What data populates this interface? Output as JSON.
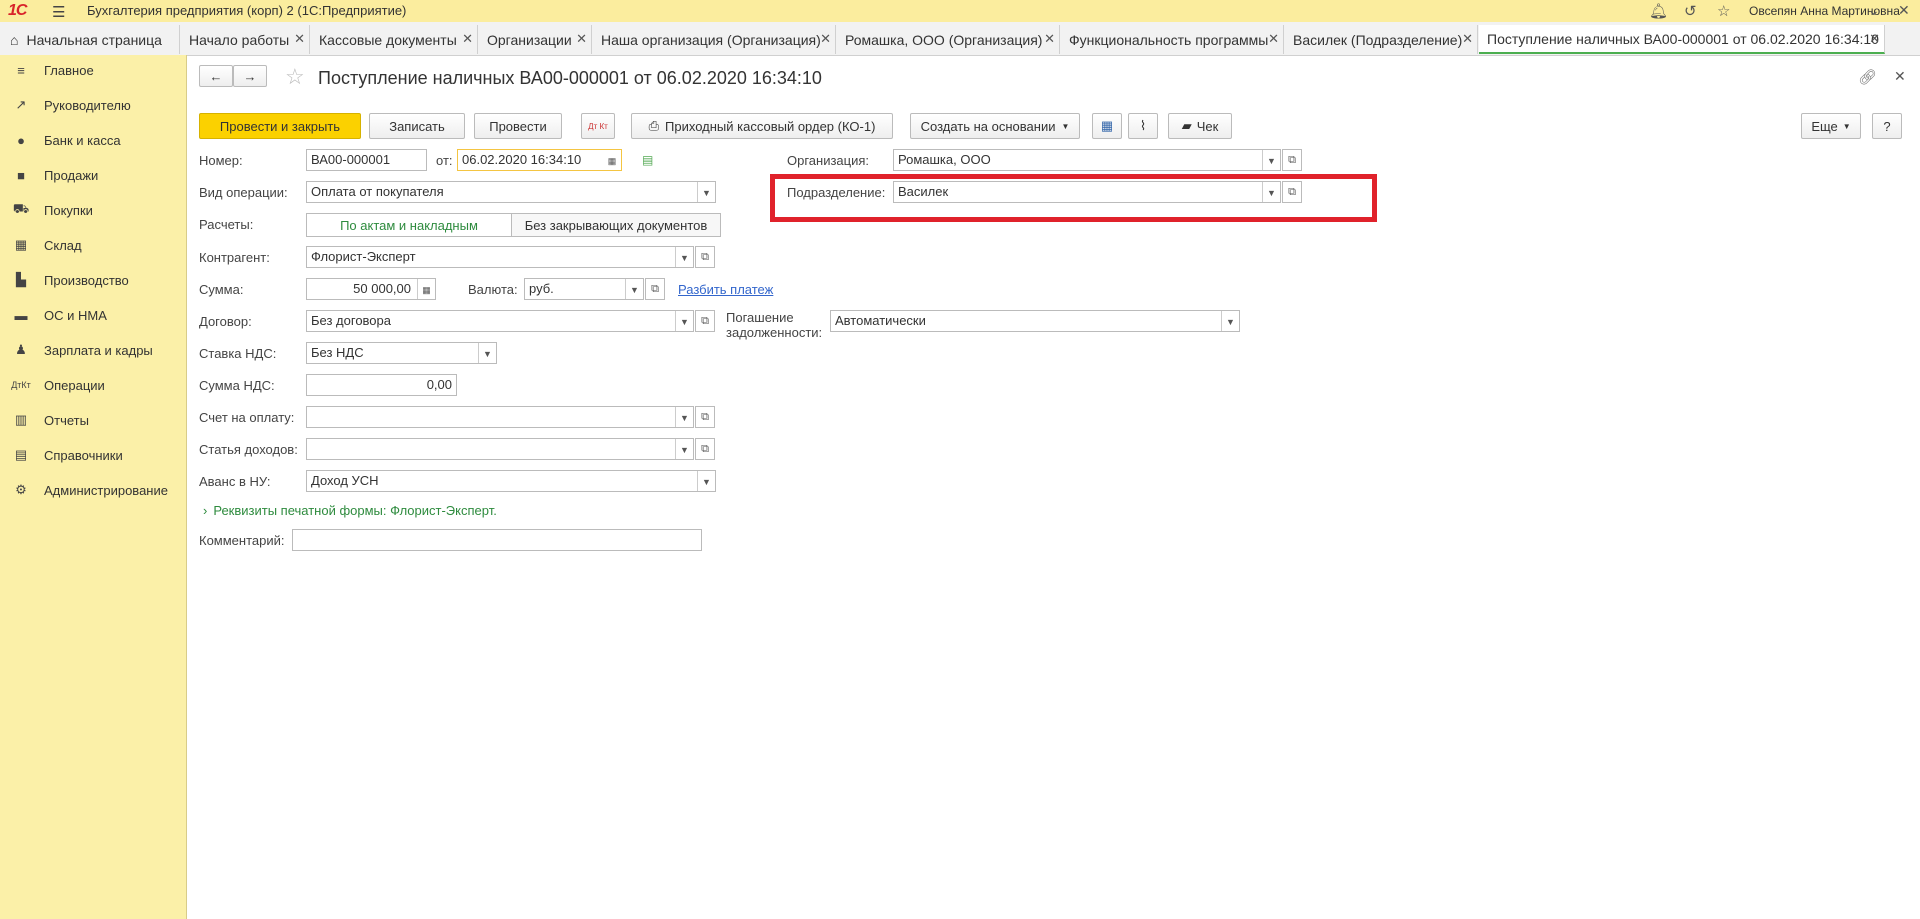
{
  "titlebar": {
    "logo": "1С",
    "app_title": "Бухгалтерия предприятия (корп) 2  (1С:Предприятие)",
    "user": "Овсепян Анна Мартиновна"
  },
  "tabs": [
    {
      "label": "Начальная страница"
    },
    {
      "label": "Начало работы"
    },
    {
      "label": "Кассовые документы"
    },
    {
      "label": "Организации"
    },
    {
      "label": "Наша организация (Организация)"
    },
    {
      "label": "Ромашка, ООО (Организация)"
    },
    {
      "label": "Функциональность программы"
    },
    {
      "label": "Василек (Подразделение)"
    },
    {
      "label": "Поступление наличных ВА00-000001 от 06.02.2020 16:34:10"
    }
  ],
  "sidebar": {
    "items": [
      {
        "label": "Главное",
        "icon": "menu-icon"
      },
      {
        "label": "Руководителю",
        "icon": "chart-up-icon"
      },
      {
        "label": "Банк и касса",
        "icon": "coin-icon"
      },
      {
        "label": "Продажи",
        "icon": "bag-icon"
      },
      {
        "label": "Покупки",
        "icon": "cart-icon"
      },
      {
        "label": "Склад",
        "icon": "grid-icon"
      },
      {
        "label": "Производство",
        "icon": "factory-icon"
      },
      {
        "label": "ОС и НМА",
        "icon": "truck-icon"
      },
      {
        "label": "Зарплата и кадры",
        "icon": "person-icon"
      },
      {
        "label": "Операции",
        "icon": "dt-kt-icon"
      },
      {
        "label": "Отчеты",
        "icon": "bar-chart-icon"
      },
      {
        "label": "Справочники",
        "icon": "books-icon"
      },
      {
        "label": "Администрирование",
        "icon": "gear-icon"
      }
    ]
  },
  "document": {
    "title": "Поступление наличных ВА00-000001 от 06.02.2020 16:34:10"
  },
  "toolbar": {
    "post_close": "Провести и закрыть",
    "save": "Записать",
    "post": "Провести",
    "dt_kt": "Дт Кт",
    "print": "Приходный кассовый ордер (КО-1)",
    "create_based": "Создать на основании",
    "receipt": "Чек",
    "more": "Еще",
    "help": "?"
  },
  "form": {
    "number_label": "Номер:",
    "number_value": "ВА00-000001",
    "from_label": "от:",
    "date_value": "06.02.2020 16:34:10",
    "op_label": "Вид операции:",
    "op_value": "Оплата от покупателя",
    "settle_label": "Расчеты:",
    "settle_opt1": "По актам и накладным",
    "settle_opt2": "Без закрывающих документов",
    "contractor_label": "Контрагент:",
    "contractor_value": "Флорист-Эксперт",
    "sum_label": "Сумма:",
    "sum_value": "50 000,00",
    "currency_label": "Валюта:",
    "currency_value": "руб.",
    "split_link": "Разбить платеж",
    "contract_label": "Договор:",
    "contract_value": "Без договора",
    "debt_label_1": "Погашение",
    "debt_label_2": "задолженности:",
    "debt_value": "Автоматически",
    "vat_rate_label": "Ставка НДС:",
    "vat_rate_value": "Без НДС",
    "vat_sum_label": "Сумма НДС:",
    "vat_sum_value": "0,00",
    "invoice_label": "Счет на оплату:",
    "invoice_value": "",
    "income_label": "Статья доходов:",
    "income_value": "",
    "advance_label": "Аванс в НУ:",
    "advance_value": "Доход УСН",
    "print_details": "Реквизиты печатной формы: Флорист-Эксперт.",
    "comment_label": "Комментарий:",
    "comment_value": "",
    "org_label": "Организация:",
    "org_value": "Ромашка, ООО",
    "dept_label": "Подразделение:",
    "dept_value": "Василек"
  },
  "colors": {
    "sidebar_bg": "#fbf0a8",
    "primary_button": "#fbd100",
    "highlight": "#e0222b",
    "active_tab_accent": "#4caf50"
  }
}
